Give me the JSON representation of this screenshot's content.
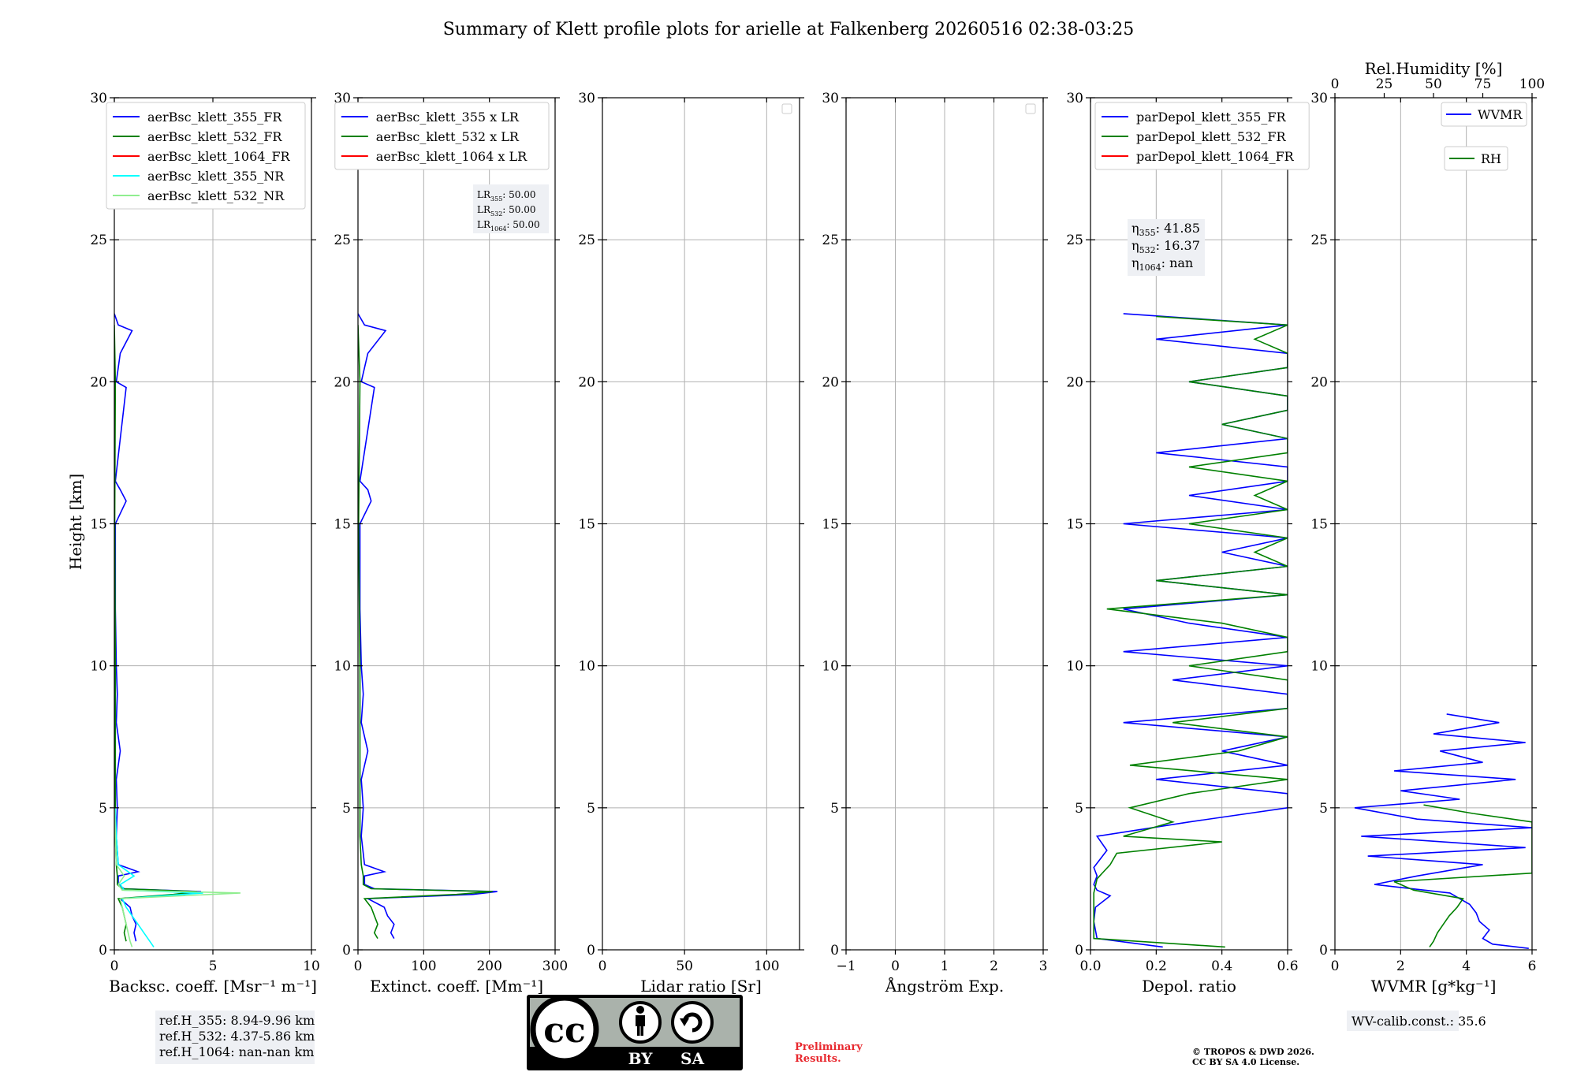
{
  "title": "Summary of Klett profile plots for arielle at Falkenberg 20260516 02:38-03:25",
  "ylabel": "Height [km]",
  "footer": {
    "ref_lines": [
      "ref.H_355: 8.94-9.96 km",
      "ref.H_532: 4.37-5.86 km",
      "ref.H_1064: nan-nan km"
    ],
    "cc_text": "cc",
    "cc_by": "BY",
    "cc_sa": "SA",
    "preliminary": [
      "Preliminary",
      "Results."
    ],
    "copyright": [
      "© TROPOS & DWD 2026.",
      "CC BY SA 4.0 License."
    ],
    "wv_calib": "WV-calib.const.: 35.6"
  },
  "colors": {
    "blue": "#0000ff",
    "green": "#008000",
    "red": "#ff0000",
    "cyan": "#00ffff",
    "lightgreen": "#90ee90",
    "grid": "#b0b0b0"
  },
  "chart_data": [
    {
      "type": "line",
      "id": "bsc",
      "xlabel": "Backsc. coeff. [Msr⁻¹ m⁻¹]",
      "xlim": [
        0,
        10
      ],
      "ylim": [
        0,
        30
      ],
      "xticks": [
        0,
        5,
        10
      ],
      "xticklabels": [
        "0",
        "5",
        "10"
      ],
      "yticks": [
        0,
        5,
        10,
        15,
        20,
        25,
        30
      ],
      "grid": true,
      "legend": "top-right",
      "series": [
        {
          "name": "aerBsc_klett_355_FR",
          "color": "#0000ff",
          "h": [
            0.3,
            0.6,
            0.9,
            1.2,
            1.5,
            1.8,
            1.95,
            2.05,
            2.15,
            2.3,
            2.6,
            2.75,
            3,
            4,
            5,
            6,
            7,
            8,
            9,
            10,
            12,
            15,
            15.8,
            16.2,
            16.5,
            19.8,
            20,
            21,
            21.8,
            22,
            22.4
          ],
          "v": [
            1.1,
            1.0,
            1.1,
            0.9,
            0.8,
            0.3,
            3.5,
            4.4,
            0.5,
            0.2,
            0.2,
            1.2,
            0.2,
            0.1,
            0.15,
            0.1,
            0.3,
            0.1,
            0.15,
            0.1,
            0.05,
            0.05,
            0.6,
            0.3,
            0.05,
            0.6,
            0.1,
            0.3,
            0.9,
            0.2,
            0
          ]
        },
        {
          "name": "aerBsc_klett_532_FR",
          "color": "#008000",
          "h": [
            0.3,
            0.6,
            0.9,
            1.2,
            1.5,
            1.8,
            1.95,
            2.05,
            2.15,
            2.3,
            2.6,
            3,
            4,
            6,
            8,
            10,
            15,
            20,
            22
          ],
          "v": [
            0.6,
            0.5,
            0.6,
            0.5,
            0.4,
            0.2,
            3.0,
            4.2,
            0.4,
            0.15,
            0.15,
            0.1,
            0.05,
            0.05,
            0.05,
            0.05,
            0.02,
            0.05,
            0
          ]
        },
        {
          "name": "aerBsc_klett_1064_FR",
          "color": "#ff0000",
          "h": [],
          "v": []
        },
        {
          "name": "aerBsc_klett_355_NR",
          "color": "#00ffff",
          "h": [
            0.1,
            0.3,
            0.6,
            0.9,
            1.2,
            1.5,
            1.8,
            2.0,
            2.1,
            2.3,
            2.6,
            3,
            4,
            5
          ],
          "v": [
            2.0,
            1.8,
            1.5,
            1.2,
            0.9,
            0.6,
            0.4,
            4.5,
            0.5,
            0.3,
            1.0,
            0.2,
            0.1,
            0.05
          ]
        },
        {
          "name": "aerBsc_klett_532_NR",
          "color": "#90ee90",
          "h": [
            0.1,
            0.3,
            0.6,
            0.9,
            1.2,
            1.5,
            1.8,
            2.0,
            2.1,
            2.3,
            2.6,
            3,
            4,
            5
          ],
          "v": [
            0.9,
            0.8,
            0.7,
            0.6,
            0.5,
            0.4,
            0.3,
            6.4,
            0.4,
            0.2,
            0.5,
            0.1,
            0.05,
            0.02
          ]
        }
      ]
    },
    {
      "type": "line",
      "id": "ext",
      "xlabel": "Extinct. coeff. [Mm⁻¹]",
      "xlim": [
        0,
        300
      ],
      "ylim": [
        0,
        30
      ],
      "xticks": [
        0,
        100,
        200,
        300
      ],
      "xticklabels": [
        "0",
        "100",
        "200",
        "300"
      ],
      "yticks": [
        0,
        5,
        10,
        15,
        20,
        25,
        30
      ],
      "grid": true,
      "legend": "top-right",
      "annotation": [
        [
          "LR",
          "355",
          ": 50.00"
        ],
        [
          "LR",
          "532",
          ": 50.00"
        ],
        [
          "LR",
          "1064",
          ": 50.00"
        ]
      ],
      "series": [
        {
          "name": "aerBsc_klett_355 x LR",
          "color": "#0000ff",
          "h": [
            0.4,
            0.6,
            0.9,
            1.2,
            1.5,
            1.8,
            1.95,
            2.05,
            2.15,
            2.3,
            2.6,
            2.75,
            3,
            4,
            5,
            6,
            7,
            8,
            9,
            10,
            12,
            15,
            15.8,
            16.2,
            16.5,
            19.8,
            20,
            21,
            21.8,
            22,
            22.4
          ],
          "v": [
            55,
            50,
            55,
            45,
            40,
            15,
            175,
            212,
            25,
            10,
            10,
            40,
            10,
            5,
            8,
            5,
            15,
            5,
            8,
            5,
            3,
            3,
            20,
            15,
            3,
            25,
            5,
            15,
            42,
            10,
            0
          ]
        },
        {
          "name": "aerBsc_klett_532 x LR",
          "color": "#008000",
          "h": [
            0.4,
            0.6,
            0.9,
            1.2,
            1.5,
            1.8,
            1.95,
            2.05,
            2.15,
            2.3,
            2.6,
            3,
            4,
            6,
            8,
            10,
            15,
            20,
            22
          ],
          "v": [
            30,
            25,
            30,
            25,
            20,
            10,
            150,
            205,
            20,
            8,
            8,
            5,
            3,
            3,
            3,
            3,
            1,
            3,
            0
          ]
        },
        {
          "name": "aerBsc_klett_1064 x LR",
          "color": "#ff0000",
          "h": [],
          "v": []
        }
      ]
    },
    {
      "type": "line",
      "id": "lr",
      "xlabel": "Lidar ratio [Sr]",
      "xlim": [
        0,
        120
      ],
      "ylim": [
        0,
        30
      ],
      "xticks": [
        0,
        50,
        100
      ],
      "xticklabels": [
        "0",
        "50",
        "100"
      ],
      "yticks": [
        0,
        5,
        10,
        15,
        20,
        25,
        30
      ],
      "grid": true,
      "legend": "top-right-empty",
      "series": []
    },
    {
      "type": "line",
      "id": "ang",
      "xlabel": "Ångström Exp.",
      "xlim": [
        -1,
        3
      ],
      "ylim": [
        0,
        30
      ],
      "xticks": [
        -1,
        0,
        1,
        2,
        3
      ],
      "xticklabels": [
        "−1",
        "0",
        "1",
        "2",
        "3"
      ],
      "yticks": [
        0,
        5,
        10,
        15,
        20,
        25,
        30
      ],
      "grid": true,
      "legend": "top-right-empty",
      "series": []
    },
    {
      "type": "line",
      "id": "depol",
      "xlabel": "Depol. ratio",
      "xlim": [
        0,
        0.6
      ],
      "ylim": [
        0,
        30
      ],
      "xticks": [
        0,
        0.2,
        0.4,
        0.6
      ],
      "xticklabels": [
        "0.0",
        "0.2",
        "0.4",
        "0.6"
      ],
      "yticks": [
        0,
        5,
        10,
        15,
        20,
        25,
        30
      ],
      "grid": true,
      "legend": "top-left",
      "annotation": [
        [
          "η",
          "355",
          ": 41.85"
        ],
        [
          "η",
          "532",
          ": 16.37"
        ],
        [
          "η",
          "1064",
          ": nan"
        ]
      ],
      "series": [
        {
          "name": "parDepol_klett_355_FR",
          "color": "#0000ff",
          "h": [
            0.1,
            0.4,
            1.0,
            1.5,
            1.9,
            2.1,
            2.3,
            2.6,
            2.9,
            3.5,
            4.0,
            4.5,
            5.0,
            5.5,
            6.0,
            6.5,
            7.0,
            7.5,
            8.0,
            8.5,
            9.0,
            9.5,
            10.0,
            10.5,
            11.0,
            11.5,
            12.0,
            12.5,
            13.0,
            13.5,
            14.0,
            14.5,
            15.0,
            15.5,
            16.0,
            16.5,
            17.0,
            17.5,
            18.0,
            18.5,
            19.0,
            19.5,
            20.0,
            20.5,
            21.0,
            21.5,
            22.0,
            22.4
          ],
          "v": [
            0.22,
            0.02,
            0.01,
            0.015,
            0.06,
            0.02,
            0.01,
            0.02,
            0.01,
            0.05,
            0.02,
            0.3,
            0.6,
            0.6,
            0.2,
            0.6,
            0.4,
            0.6,
            0.1,
            0.6,
            0.6,
            0.25,
            0.6,
            0.1,
            0.6,
            0.3,
            0.1,
            0.6,
            0.2,
            0.6,
            0.4,
            0.6,
            0.1,
            0.6,
            0.3,
            0.6,
            0.6,
            0.2,
            0.6,
            0.4,
            0.6,
            0.6,
            0.3,
            0.6,
            0.6,
            0.2,
            0.6,
            0.1
          ]
        },
        {
          "name": "parDepol_klett_532_FR",
          "color": "#008000",
          "h": [
            0.1,
            0.4,
            1.0,
            1.5,
            2.0,
            2.5,
            3.0,
            3.4,
            3.8,
            4.0,
            4.5,
            5.0,
            5.5,
            6.0,
            6.5,
            7.0,
            7.5,
            8.0,
            8.5,
            9.0,
            9.5,
            10.0,
            10.5,
            11.0,
            11.5,
            12.0,
            12.5,
            13.0,
            13.5,
            14.0,
            14.5,
            15.0,
            15.5,
            16.0,
            16.5,
            17.0,
            17.5,
            18.0,
            18.5,
            19.0,
            19.5,
            20.0,
            20.5,
            21.0,
            21.5,
            22.0,
            22.3
          ],
          "v": [
            0.41,
            0.01,
            0.01,
            0.01,
            0.01,
            0.02,
            0.06,
            0.08,
            0.4,
            0.1,
            0.25,
            0.12,
            0.3,
            0.6,
            0.12,
            0.45,
            0.6,
            0.25,
            0.6,
            0.6,
            0.6,
            0.3,
            0.6,
            0.6,
            0.4,
            0.05,
            0.6,
            0.2,
            0.6,
            0.5,
            0.6,
            0.3,
            0.6,
            0.5,
            0.6,
            0.3,
            0.6,
            0.6,
            0.4,
            0.6,
            0.6,
            0.3,
            0.6,
            0.6,
            0.5,
            0.6,
            0.2
          ]
        },
        {
          "name": "parDepol_klett_1064_FR",
          "color": "#ff0000",
          "h": [],
          "v": []
        }
      ]
    },
    {
      "type": "line",
      "id": "wv",
      "xlabel": "WVMR [g*kg⁻¹]",
      "x2label": "Rel.Humidity [%]",
      "xlim": [
        0,
        6
      ],
      "ylim": [
        0,
        30
      ],
      "xticks": [
        0,
        2,
        4,
        6
      ],
      "xticklabels": [
        "0",
        "2",
        "4",
        "6"
      ],
      "x2lim": [
        0,
        100
      ],
      "x2ticks": [
        0,
        25,
        50,
        75,
        100
      ],
      "x2ticklabels": [
        "0",
        "25",
        "50",
        "75",
        "100"
      ],
      "yticks": [
        0,
        5,
        10,
        15,
        20,
        25,
        30
      ],
      "grid": true,
      "legend": "split-right",
      "series": [
        {
          "name": "WVMR",
          "color": "#0000ff",
          "h": [
            0.05,
            0.2,
            0.4,
            0.7,
            1.0,
            1.3,
            1.6,
            2.0,
            2.3,
            2.6,
            3.0,
            3.3,
            3.6,
            4.0,
            4.3,
            4.6,
            5.0,
            5.3,
            5.6,
            6.0,
            6.3,
            6.6,
            7.0,
            7.3,
            7.6,
            8.0,
            8.3
          ],
          "v": [
            5.9,
            4.8,
            4.5,
            4.7,
            4.4,
            4.3,
            4.1,
            3.5,
            1.2,
            2.5,
            4.5,
            1.0,
            5.8,
            0.8,
            6.0,
            2.5,
            0.6,
            3.8,
            2.0,
            5.5,
            1.8,
            4.5,
            3.2,
            5.8,
            3.0,
            5.0,
            3.4
          ]
        },
        {
          "name": "RH",
          "color": "#008000",
          "axis": "x2",
          "h": [
            0.1,
            0.3,
            0.6,
            0.9,
            1.2,
            1.5,
            1.8,
            2.1,
            2.4,
            2.7,
            3.0,
            3.3,
            3.6,
            3.9,
            4.2,
            4.5,
            4.8,
            5.1
          ],
          "v": [
            48,
            50,
            52,
            55,
            58,
            62,
            65,
            40,
            30,
            100,
            100,
            100,
            100,
            100,
            100,
            100,
            70,
            45
          ]
        }
      ]
    }
  ]
}
